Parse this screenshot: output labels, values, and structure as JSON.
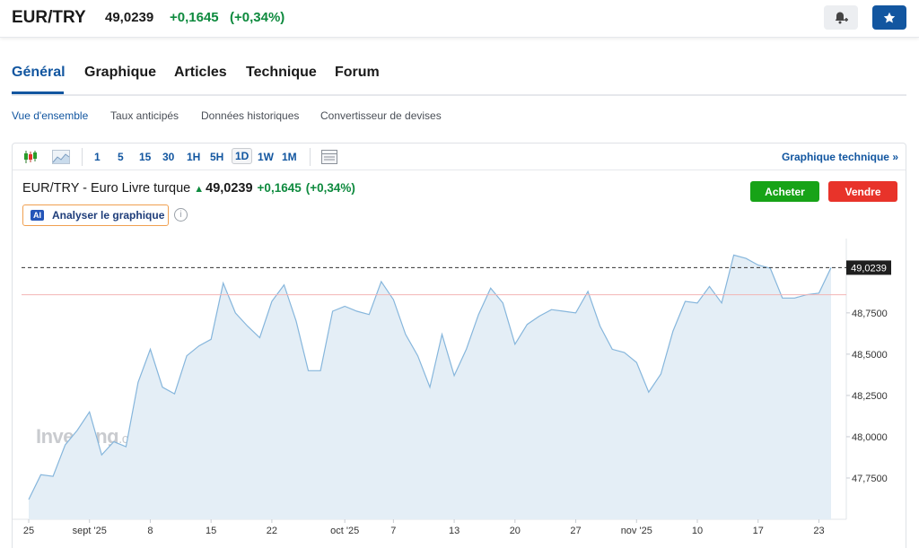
{
  "header": {
    "symbol": "EUR/TRY",
    "price": "49,0239",
    "change": "+0,1645",
    "change_pct": "(+0,34%)"
  },
  "tabs": [
    {
      "label": "Général",
      "active": true
    },
    {
      "label": "Graphique"
    },
    {
      "label": "Articles"
    },
    {
      "label": "Technique"
    },
    {
      "label": "Forum"
    }
  ],
  "subtabs": [
    {
      "label": "Vue d'ensemble",
      "active": true
    },
    {
      "label": "Taux anticipés"
    },
    {
      "label": "Données historiques"
    },
    {
      "label": "Convertisseur de devises"
    }
  ],
  "toolbar": {
    "timeframes": [
      "1",
      "5",
      "15",
      "30",
      "1H",
      "5H",
      "1D",
      "1W",
      "1M"
    ],
    "selected": "1D",
    "link": "Graphique technique »"
  },
  "chart_header": {
    "name": "EUR/TRY - Euro Livre turque",
    "price": "49,0239",
    "change": "+0,1645",
    "change_pct": "(+0,34%)",
    "buy": "Acheter",
    "sell": "Vendre",
    "ai_badge": "AI",
    "ai_label": "Analyser le graphique",
    "info": "i"
  },
  "watermark": {
    "brand": "Investing",
    "suffix": ".com"
  },
  "colors": {
    "accent": "#1256a0",
    "up": "#0e8a3e",
    "buy": "#17a317",
    "sell": "#e8332a",
    "line": "#86b6dc",
    "fill": "#e4eef6"
  },
  "chart_data": {
    "type": "area",
    "ylim": [
      47.5,
      49.2
    ],
    "yticks": [
      {
        "value": 47.75,
        "label": "47,7500"
      },
      {
        "value": 48.0,
        "label": "48,0000"
      },
      {
        "value": 48.25,
        "label": "48,2500"
      },
      {
        "value": 48.5,
        "label": "48,5000"
      },
      {
        "value": 48.75,
        "label": "48,7500"
      }
    ],
    "last_value": 49.0239,
    "last_label": "49,0239",
    "reference_value": 48.86,
    "xticks": [
      {
        "index": 0,
        "label": "25"
      },
      {
        "index": 5,
        "label": "sept '25"
      },
      {
        "index": 10,
        "label": "8"
      },
      {
        "index": 15,
        "label": "15"
      },
      {
        "index": 20,
        "label": "22"
      },
      {
        "index": 26,
        "label": "oct '25"
      },
      {
        "index": 30,
        "label": "7"
      },
      {
        "index": 35,
        "label": "13"
      },
      {
        "index": 40,
        "label": "20"
      },
      {
        "index": 45,
        "label": "27"
      },
      {
        "index": 50,
        "label": "nov '25"
      },
      {
        "index": 55,
        "label": "10"
      },
      {
        "index": 60,
        "label": "17"
      },
      {
        "index": 65,
        "label": "23"
      }
    ],
    "values": [
      47.62,
      47.77,
      47.76,
      47.95,
      48.04,
      48.15,
      47.89,
      47.97,
      47.94,
      48.33,
      48.53,
      48.3,
      48.26,
      48.49,
      48.55,
      48.59,
      48.93,
      48.75,
      48.67,
      48.6,
      48.82,
      48.92,
      48.7,
      48.4,
      48.4,
      48.76,
      48.79,
      48.76,
      48.74,
      48.94,
      48.83,
      48.62,
      48.49,
      48.3,
      48.62,
      48.37,
      48.53,
      48.74,
      48.9,
      48.81,
      48.56,
      48.68,
      48.73,
      48.77,
      48.76,
      48.75,
      48.88,
      48.67,
      48.53,
      48.51,
      48.45,
      48.27,
      48.38,
      48.64,
      48.82,
      48.81,
      48.91,
      48.81,
      49.1,
      49.08,
      49.04,
      49.02,
      48.84,
      48.84,
      48.86,
      48.87,
      49.0239
    ]
  }
}
